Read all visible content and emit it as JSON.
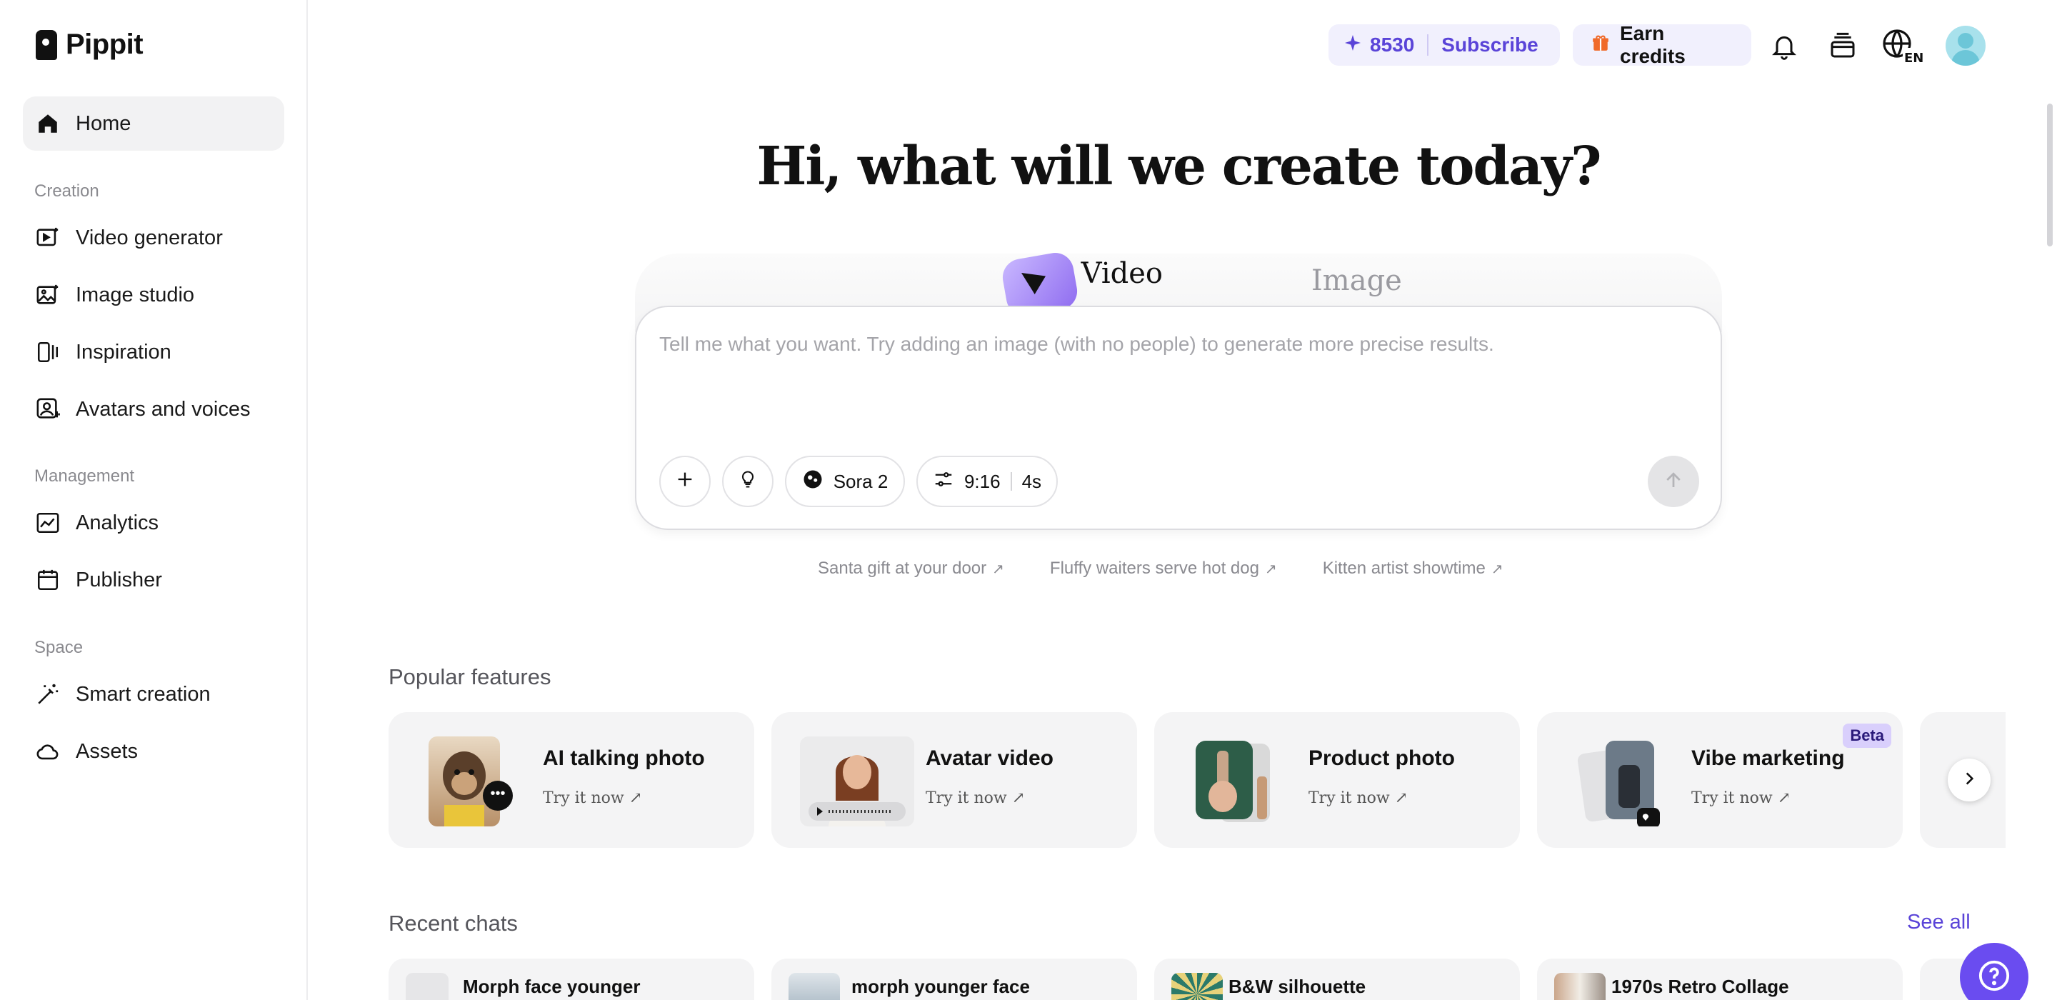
{
  "app": {
    "name": "Pippit"
  },
  "sidebar": {
    "home": "Home",
    "sections": [
      {
        "title": "Creation",
        "items": [
          "Video generator",
          "Image studio",
          "Inspiration",
          "Avatars and voices"
        ]
      },
      {
        "title": "Management",
        "items": [
          "Analytics",
          "Publisher"
        ]
      },
      {
        "title": "Space",
        "items": [
          "Smart creation",
          "Assets"
        ]
      }
    ]
  },
  "topbar": {
    "credits": "8530",
    "subscribe": "Subscribe",
    "earn": "Earn credits",
    "language": "EN"
  },
  "hero": {
    "title": "Hi, what will we create today?",
    "tabs": {
      "video": "Video",
      "image": "Image"
    },
    "active_tab": "Video",
    "placeholder": "Tell me what you want. Try adding an image (with no people) to generate more precise results.",
    "model": "Sora 2",
    "ratio": "9:16",
    "duration": "4s"
  },
  "suggestions": [
    "Santa gift at your door",
    "Fluffy waiters serve hot dog",
    "Kitten artist showtime"
  ],
  "popular": {
    "title": "Popular features",
    "cards": [
      {
        "title": "AI talking photo",
        "cta": "Try it now"
      },
      {
        "title": "Avatar video",
        "cta": "Try it now"
      },
      {
        "title": "Product photo",
        "cta": "Try it now"
      },
      {
        "title": "Vibe marketing",
        "cta": "Try it now",
        "badge": "Beta"
      }
    ]
  },
  "recent": {
    "title": "Recent chats",
    "see_all": "See all",
    "chats": [
      "Morph face younger",
      "morph younger face",
      "B&W silhouette",
      "1970s Retro Collage"
    ]
  },
  "colors": {
    "accent": "#5a44d8",
    "pill_bg": "#f1f0fd",
    "help": "#6a4cf0"
  }
}
